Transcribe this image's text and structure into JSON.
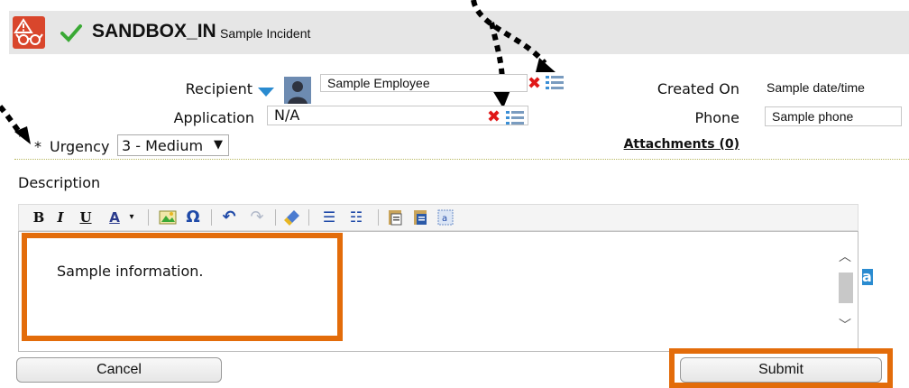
{
  "header": {
    "title": "SANDBOX_IN",
    "subtitle": "Sample Incident"
  },
  "form": {
    "recipient_label": "Recipient",
    "recipient_value": "Sample Employee",
    "application_label": "Application",
    "application_value": "N/A",
    "urgency_required_marker": "*",
    "urgency_label": "Urgency",
    "urgency_value": "3 - Medium",
    "created_on_label": "Created On",
    "created_on_value": "Sample date/time",
    "phone_label": "Phone",
    "phone_value": "Sample phone",
    "attachments_link": "Attachments (0)",
    "description_label": "Description"
  },
  "toolbar": {
    "bold": "B",
    "italic": "I",
    "underline": "U",
    "font_color": "A",
    "special_char": "Ω"
  },
  "editor": {
    "content": "Sample information."
  },
  "spellcheck_label": "ab",
  "buttons": {
    "cancel": "Cancel",
    "submit": "Submit"
  },
  "colors": {
    "highlight": "#e36c0a",
    "header_bg": "#e6e6e6",
    "app_icon_bg": "#d9462c",
    "check_green": "#3aa935",
    "delete_red": "#e01818",
    "link_blue": "#2a8bd0"
  }
}
